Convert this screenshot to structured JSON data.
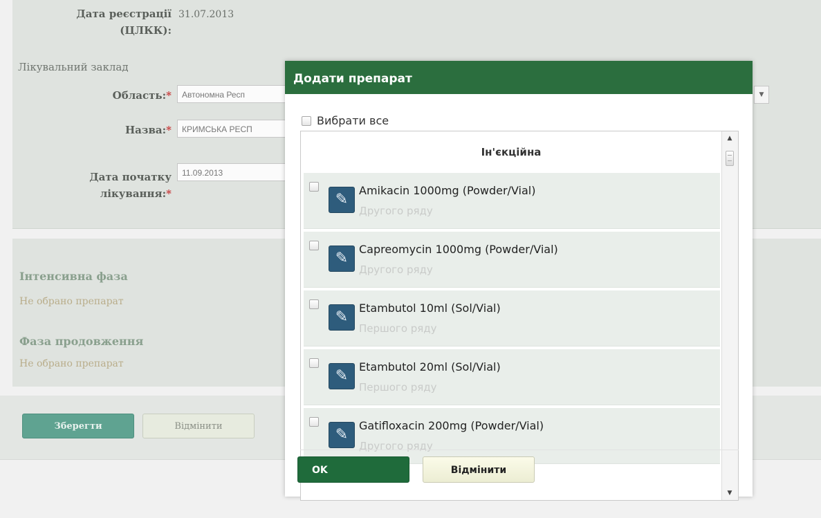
{
  "form": {
    "registration_date_label_line1": "Дата реєстрації",
    "registration_date_label_line2": "(ЦЛКК):",
    "registration_date_value": "31.07.2013",
    "facility_caption": "Лікувальний заклад",
    "region_label": "Область:",
    "region_value": "Автономна Респ",
    "name_label": "Назва:",
    "name_value": "КРИМСЬКА РЕСП",
    "start_date_label_line1": "Дата початку",
    "start_date_label_line2": "лікування:",
    "start_date_value": "11.09.2013",
    "required_mark": "*"
  },
  "phases": {
    "intensive_title": "Інтенсивна фаза",
    "intensive_none": "Не обрано препарат",
    "continuation_title": "Фаза продовження",
    "continuation_none": "Не обрано препарат"
  },
  "form_buttons": {
    "save": "Зберегти",
    "cancel": "Відмінити"
  },
  "modal": {
    "title": "Додати препарат",
    "select_all": "Вибрати все",
    "group_header": "Ін'єкційна",
    "drugs": [
      {
        "name": "Amikacin 1000mg (Powder/Vial)",
        "line": "Другого ряду"
      },
      {
        "name": "Capreomycin 1000mg (Powder/Vial)",
        "line": "Другого ряду"
      },
      {
        "name": "Etambutol 10ml (Sol/Vial)",
        "line": "Першого ряду"
      },
      {
        "name": "Etambutol 20ml (Sol/Vial)",
        "line": "Першого ряду"
      },
      {
        "name": "Gatifloxacin 200mg (Powder/Vial)",
        "line": "Другого ряду"
      }
    ],
    "ok": "OK",
    "cancel": "Відмінити"
  },
  "icons": {
    "drug_icon": "syringe-icon",
    "scroll_up": "▲",
    "scroll_down": "▼",
    "select_arrow": "▼"
  },
  "colors": {
    "modal_header": "#2b6e3e",
    "ok_button": "#1f6b3b",
    "save_button": "#5fa391"
  }
}
